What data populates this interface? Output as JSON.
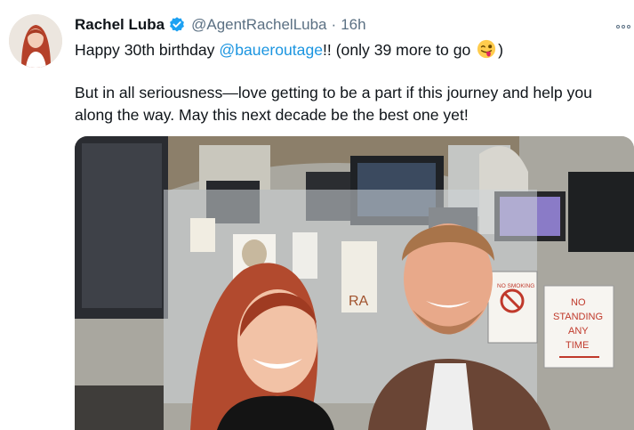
{
  "tweet": {
    "author_name": "Rachel Luba",
    "handle": "@AgentRachelLuba",
    "separator": "·",
    "time": "16h",
    "line1_pre": "Happy 30th birthday ",
    "mention": "@baueroutage",
    "line1_post_a": "!! (only 39 more to go ",
    "line1_post_b": ")",
    "line2": "But in all seriousness—love getting to be a part if this journey and help you",
    "line3": "along the way. May this next decade be the best one yet!"
  },
  "photo": {
    "sign_no_smoking": "NO SMOKING",
    "sign_no_standing_line1": "NO",
    "sign_no_standing_line2": "STANDING",
    "sign_no_standing_line3": "ANY",
    "sign_no_standing_line4": "TIME"
  },
  "icons": {
    "verified": "verified-badge-icon",
    "more": "more-options-icon",
    "emoji": "winking-tongue-emoji"
  },
  "colors": {
    "link": "#1b95e0",
    "verified": "#1da1f2",
    "muted": "#5b7083",
    "text": "#0f1419"
  }
}
